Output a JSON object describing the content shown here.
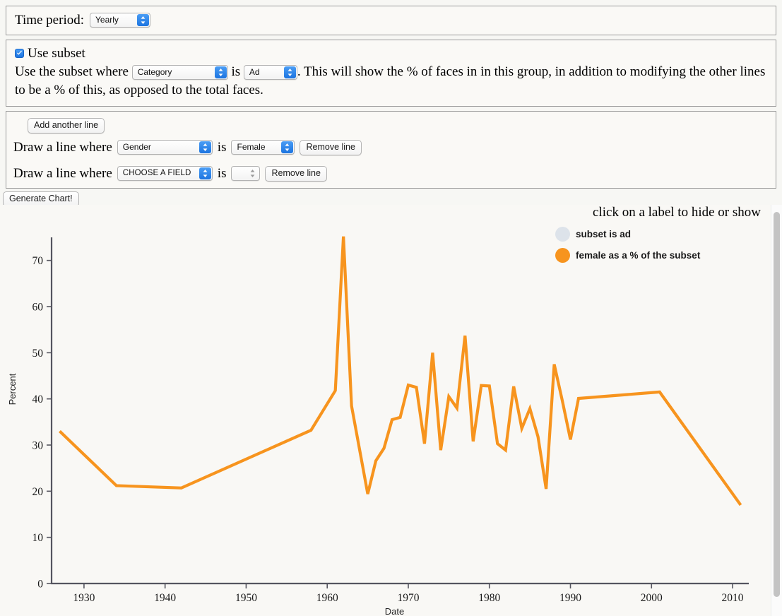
{
  "controls": {
    "time_period": {
      "label": "Time period:",
      "value": "Yearly"
    },
    "subset": {
      "checkbox_label": "Use subset",
      "checked": true,
      "prefix": "Use the subset where",
      "field_value": "Category",
      "is_word": "is",
      "value_value": "Ad",
      "description": ". This will show the % of faces in in this group, in addition to modifying the other lines to be a % of this, as opposed to the total faces."
    },
    "lines": {
      "add_button": "Add another line",
      "rows": [
        {
          "prefix": "Draw a line where",
          "field_value": "Gender",
          "is_word": "is",
          "value_value": "Female",
          "remove_label": "Remove line"
        },
        {
          "prefix": "Draw a line where",
          "field_value": "CHOOSE A FIELD",
          "is_word": "is",
          "value_value": "",
          "remove_label": "Remove line"
        }
      ]
    },
    "generate_button": "Generate Chart!"
  },
  "chart_legend": {
    "note": "click on a label to hide or show",
    "items": [
      {
        "label": "subset is ad",
        "color": "#dde3ea",
        "hidden": true
      },
      {
        "label": "female as a % of the subset",
        "color": "#f7941e",
        "hidden": false
      }
    ]
  },
  "chart_data": {
    "type": "line",
    "title": "",
    "xlabel": "Date",
    "ylabel": "Percent",
    "xlim": [
      1926,
      2012
    ],
    "ylim": [
      0,
      75
    ],
    "xticks": [
      1930,
      1940,
      1950,
      1960,
      1970,
      1980,
      1990,
      2000,
      2010
    ],
    "yticks": [
      0,
      10,
      20,
      30,
      40,
      50,
      60,
      70
    ],
    "grid": false,
    "legend_position": "top-right",
    "series": [
      {
        "name": "female as a % of the subset",
        "color": "#f7941e",
        "x": [
          1927,
          1934,
          1942,
          1958,
          1961,
          1962,
          1963,
          1965,
          1966,
          1967,
          1968,
          1969,
          1970,
          1971,
          1972,
          1973,
          1974,
          1975,
          1976,
          1977,
          1978,
          1979,
          1980,
          1981,
          1982,
          1983,
          1984,
          1985,
          1986,
          1987,
          1988,
          1989,
          1990,
          1991,
          2001,
          2011
        ],
        "y": [
          33.0,
          21.2,
          20.7,
          33.2,
          41.8,
          75.2,
          38.5,
          19.4,
          26.6,
          29.3,
          35.5,
          36.0,
          43.0,
          42.5,
          30.3,
          50.0,
          28.9,
          40.5,
          38.0,
          53.7,
          30.8,
          42.9,
          42.8,
          30.3,
          28.9,
          42.7,
          33.6,
          37.9,
          31.8,
          20.5,
          47.5,
          39.6,
          31.2,
          40.1,
          41.5,
          17.0
        ]
      },
      {
        "name": "subset is ad",
        "color": "#dde3ea",
        "hidden": true,
        "x": [],
        "y": []
      }
    ]
  }
}
